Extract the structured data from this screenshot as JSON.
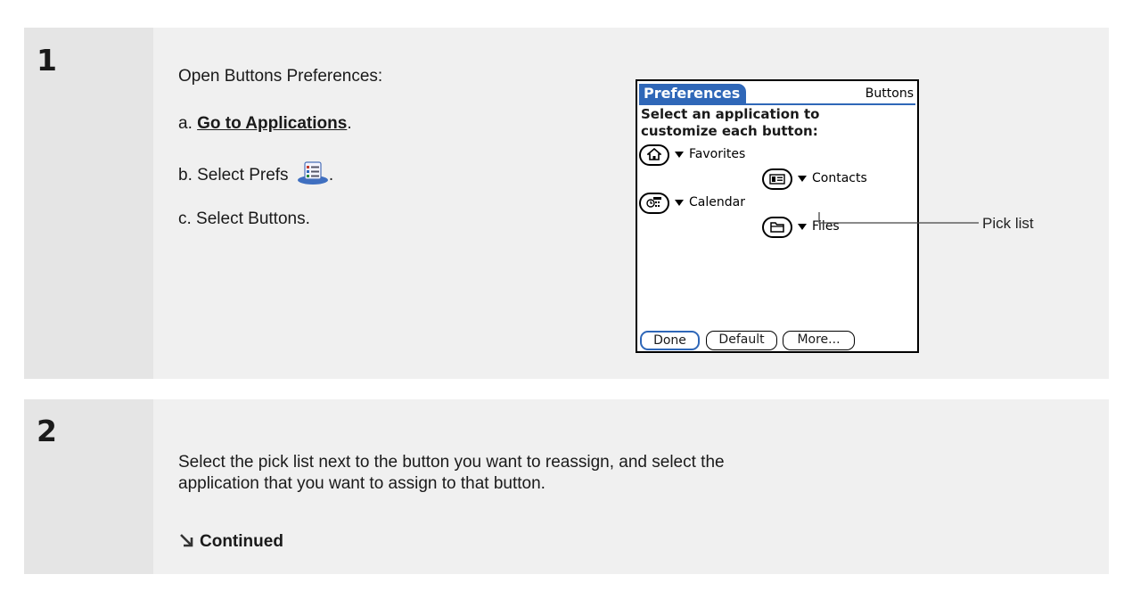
{
  "step1": {
    "number": "1",
    "heading": "Open Buttons Preferences:",
    "item_a_prefix": "a. ",
    "item_a_link": "Go to Applications",
    "item_a_suffix": ".",
    "item_b": "b. Select Prefs",
    "item_b_suffix": ".",
    "item_c": "c. Select Buttons."
  },
  "device": {
    "title": "Preferences",
    "section": "Buttons",
    "instruction_line1": "Select an application to",
    "instruction_line2": "customize each button:",
    "assignments": [
      {
        "icon": "home-icon",
        "app": "Favorites"
      },
      {
        "icon": "contacts-icon",
        "app": "Contacts"
      },
      {
        "icon": "calendar-icon",
        "app": "Calendar"
      },
      {
        "icon": "files-icon",
        "app": "Files"
      }
    ],
    "buttons": {
      "done": "Done",
      "default": "Default",
      "more": "More..."
    }
  },
  "callout": "Pick list",
  "step2": {
    "number": "2",
    "line1": "Select the pick list next to the button you want to reassign, and select the",
    "line2": "application that you want to assign to that button.",
    "continued": "Continued"
  },
  "colors": {
    "accent": "#2f67b8",
    "block_bg": "#e5e5e5",
    "panel_bg": "#f0f0f0"
  }
}
